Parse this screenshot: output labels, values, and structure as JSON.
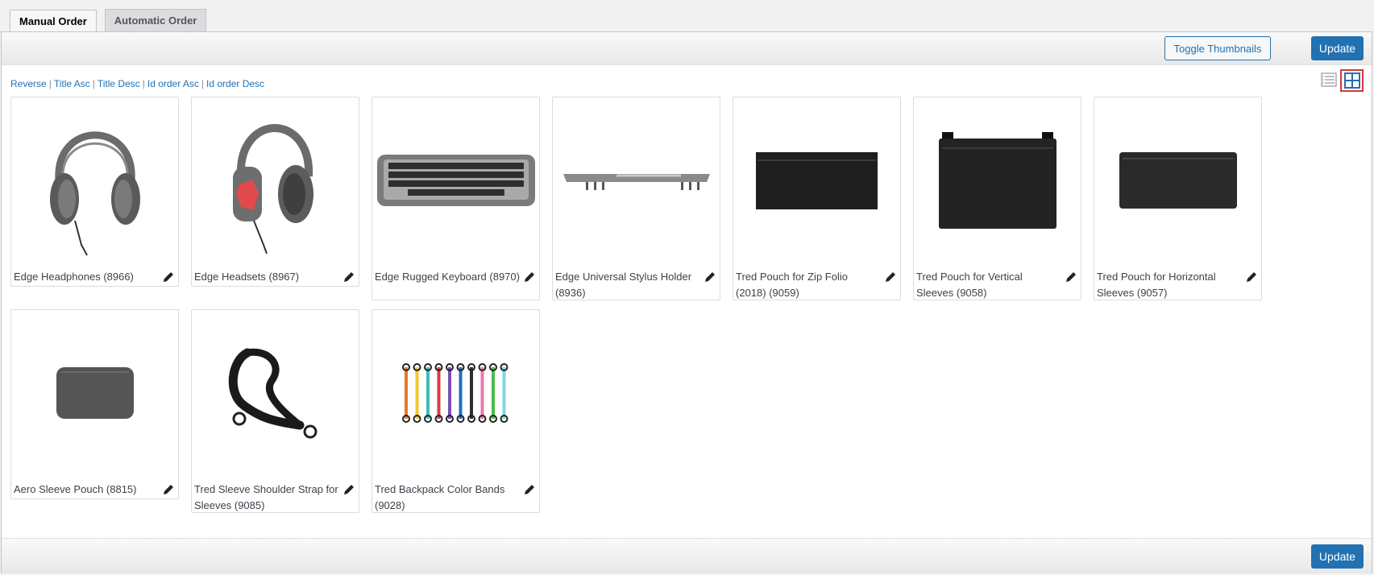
{
  "tabs": [
    {
      "label": "Manual Order",
      "active": true
    },
    {
      "label": "Automatic Order",
      "active": false
    }
  ],
  "toolbar": {
    "toggle_thumbnails_label": "Toggle Thumbnails",
    "update_label": "Update"
  },
  "sort_links": [
    "Reverse",
    "Title Asc",
    "Title Desc",
    "Id order Asc",
    "Id order Desc"
  ],
  "view_modes": {
    "list_icon": "list-view-icon",
    "grid_icon": "grid-view-icon",
    "selected": "grid"
  },
  "products": [
    {
      "title": "Edge Headphones (8966)",
      "image": "headphones"
    },
    {
      "title": "Edge Headsets (8967)",
      "image": "headset-red"
    },
    {
      "title": "Edge Rugged Keyboard (8970)",
      "image": "keyboard"
    },
    {
      "title": "Edge Universal Stylus Holder (8936)",
      "image": "stylus-holder"
    },
    {
      "title": "Tred Pouch for Zip Folio (2018) (9059)",
      "image": "pouch-zip"
    },
    {
      "title": "Tred Pouch for Vertical Sleeves (9058)",
      "image": "pouch-vertical"
    },
    {
      "title": "Tred Pouch for Horizontal Sleeves (9057)",
      "image": "pouch-horizontal"
    },
    {
      "title": "Aero Sleeve Pouch (8815)",
      "image": "aero-pouch"
    },
    {
      "title": "Tred Sleeve Shoulder Strap for Sleeves (9085)",
      "image": "shoulder-strap"
    },
    {
      "title": "Tred Backpack Color Bands (9028)",
      "image": "color-bands"
    }
  ],
  "colors": {
    "accent": "#2271b1",
    "highlight": "#d63638",
    "band_colors": [
      "#e8782a",
      "#f4c72f",
      "#3bbfb0",
      "#d93c3c",
      "#7a4fb3",
      "#1f6fb8",
      "#2f2f2f",
      "#e87aa7",
      "#4cba4c",
      "#7fd6e8"
    ]
  }
}
